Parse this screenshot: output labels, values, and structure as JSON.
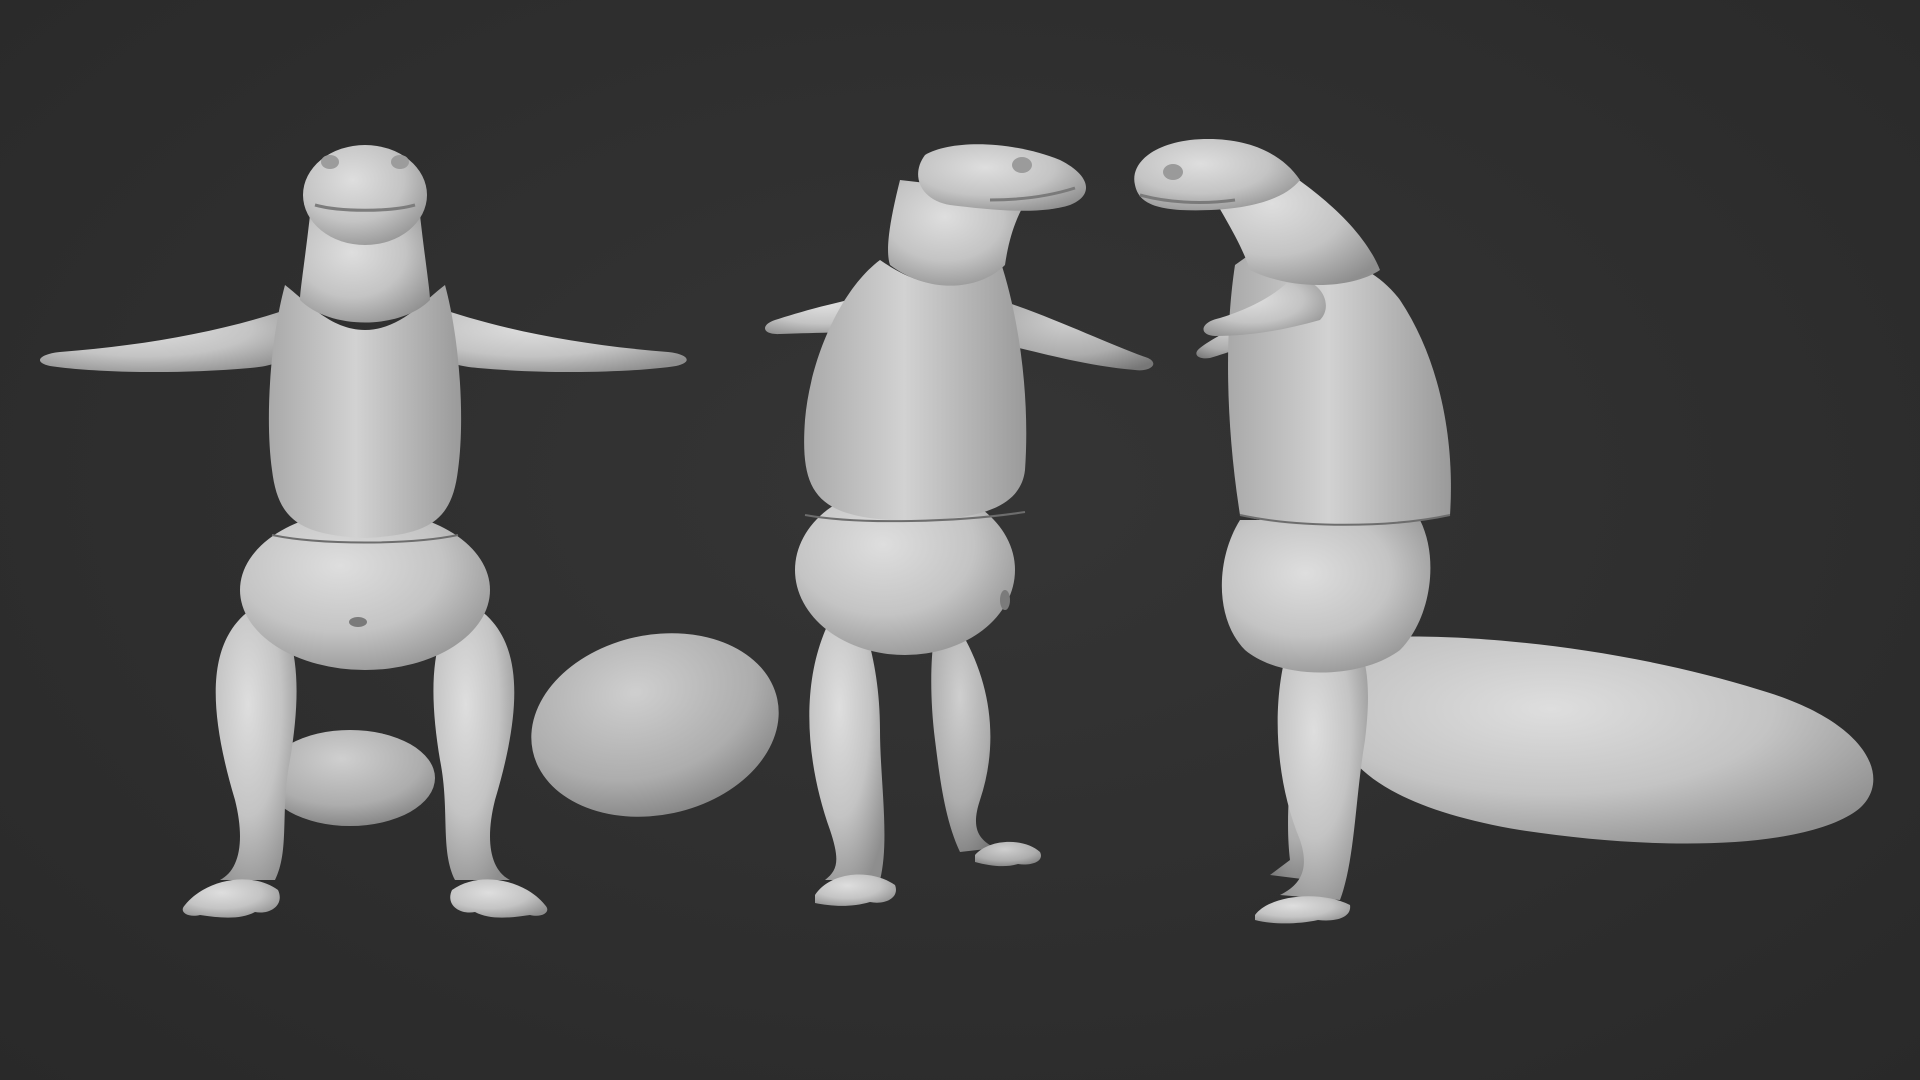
{
  "scene": {
    "background_color": "#2f2f2f",
    "material_color": "#c9c9c9",
    "shadow_color": "#8a8a8a",
    "views": [
      {
        "view": "front"
      },
      {
        "view": "three-quarter"
      },
      {
        "view": "side"
      }
    ]
  }
}
